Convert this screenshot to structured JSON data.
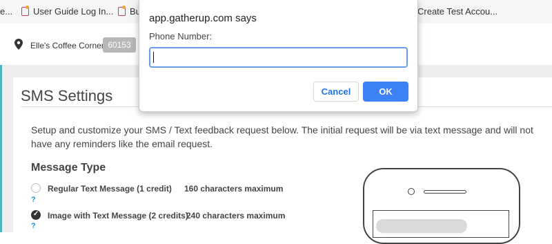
{
  "bookmarks": [
    {
      "label": "e..."
    },
    {
      "label": "User Guide Log In..."
    },
    {
      "label": "Bu"
    },
    {
      "label": "Create Test Accou..."
    }
  ],
  "location": {
    "name": "Elle's Coffee Corner",
    "id_badge": "60153",
    "icon": "map-pin-icon"
  },
  "page": {
    "title": "SMS Settings",
    "description": "Setup and customize your SMS / Text feedback request below. The initial request will be via text message and will not have any reminders like the email request.",
    "message_type": {
      "heading": "Message Type",
      "options": [
        {
          "label": "Regular Text Message (1 credit)",
          "limit": "160 characters maximum",
          "selected": false,
          "help": "?"
        },
        {
          "label": "Image with Text Message (2 credits)",
          "limit": "240 characters maximum",
          "selected": true,
          "help": "?"
        }
      ]
    }
  },
  "dialog": {
    "title": "app.gatherup.com says",
    "prompt": "Phone Number:",
    "input_value": "",
    "cancel_label": "Cancel",
    "ok_label": "OK"
  },
  "colors": {
    "accent": "#3b82f6",
    "teal_edge": "#4bb5c1",
    "help_link": "#2a8fd6",
    "badge": "#b7b7b7"
  }
}
